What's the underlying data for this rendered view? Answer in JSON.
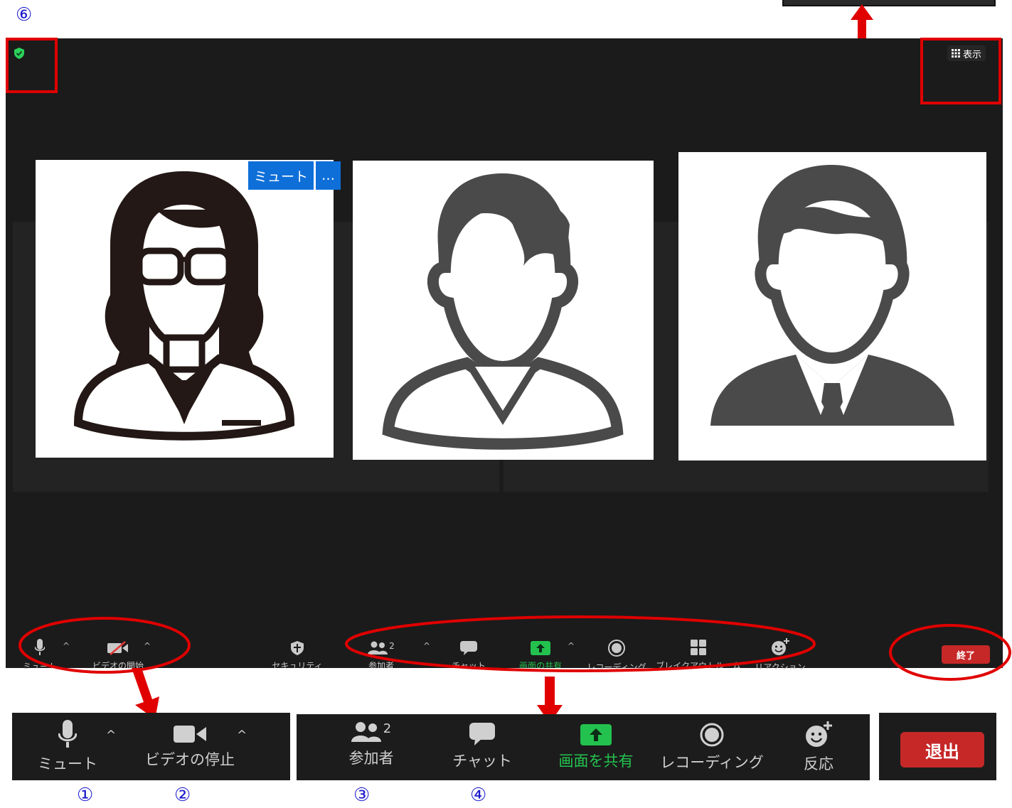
{
  "annotations": {
    "top_marker": "⑥",
    "bottom_markers": [
      "①",
      "②",
      "③",
      "④"
    ]
  },
  "meeting": {
    "security_badge_color": "#2bd15a",
    "view_button": {
      "label": "表示",
      "icon": "grid-icon"
    },
    "participant_mute_button": "ミュート",
    "participant_more_button": "…",
    "participants": [
      {
        "avatar": "woman-with-glasses-icon"
      },
      {
        "avatar": "young-man-icon"
      },
      {
        "avatar": "businessman-icon"
      }
    ],
    "toolbar": {
      "mute": "ミュート",
      "video": "ビデオの開始",
      "security": "セキュリティ",
      "participants": "参加者",
      "participants_count": "2",
      "chat": "チャット",
      "share": "画面の共有",
      "record": "レコーディング",
      "breakout": "ブレイクアウトルーム",
      "reactions": "リアクション",
      "end": "終了"
    }
  },
  "zoom_detail": {
    "mute": "ミュート",
    "video_stop": "ビデオの停止",
    "participants": "参加者",
    "participants_count": "2",
    "chat": "チャット",
    "share": "画面を共有",
    "record": "レコーディング",
    "reaction": "反応",
    "leave": "退出"
  },
  "colors": {
    "accent_red": "#e00000",
    "share_green": "#23c24e",
    "leave_red": "#c62828",
    "marker_blue": "#1a1acc"
  }
}
